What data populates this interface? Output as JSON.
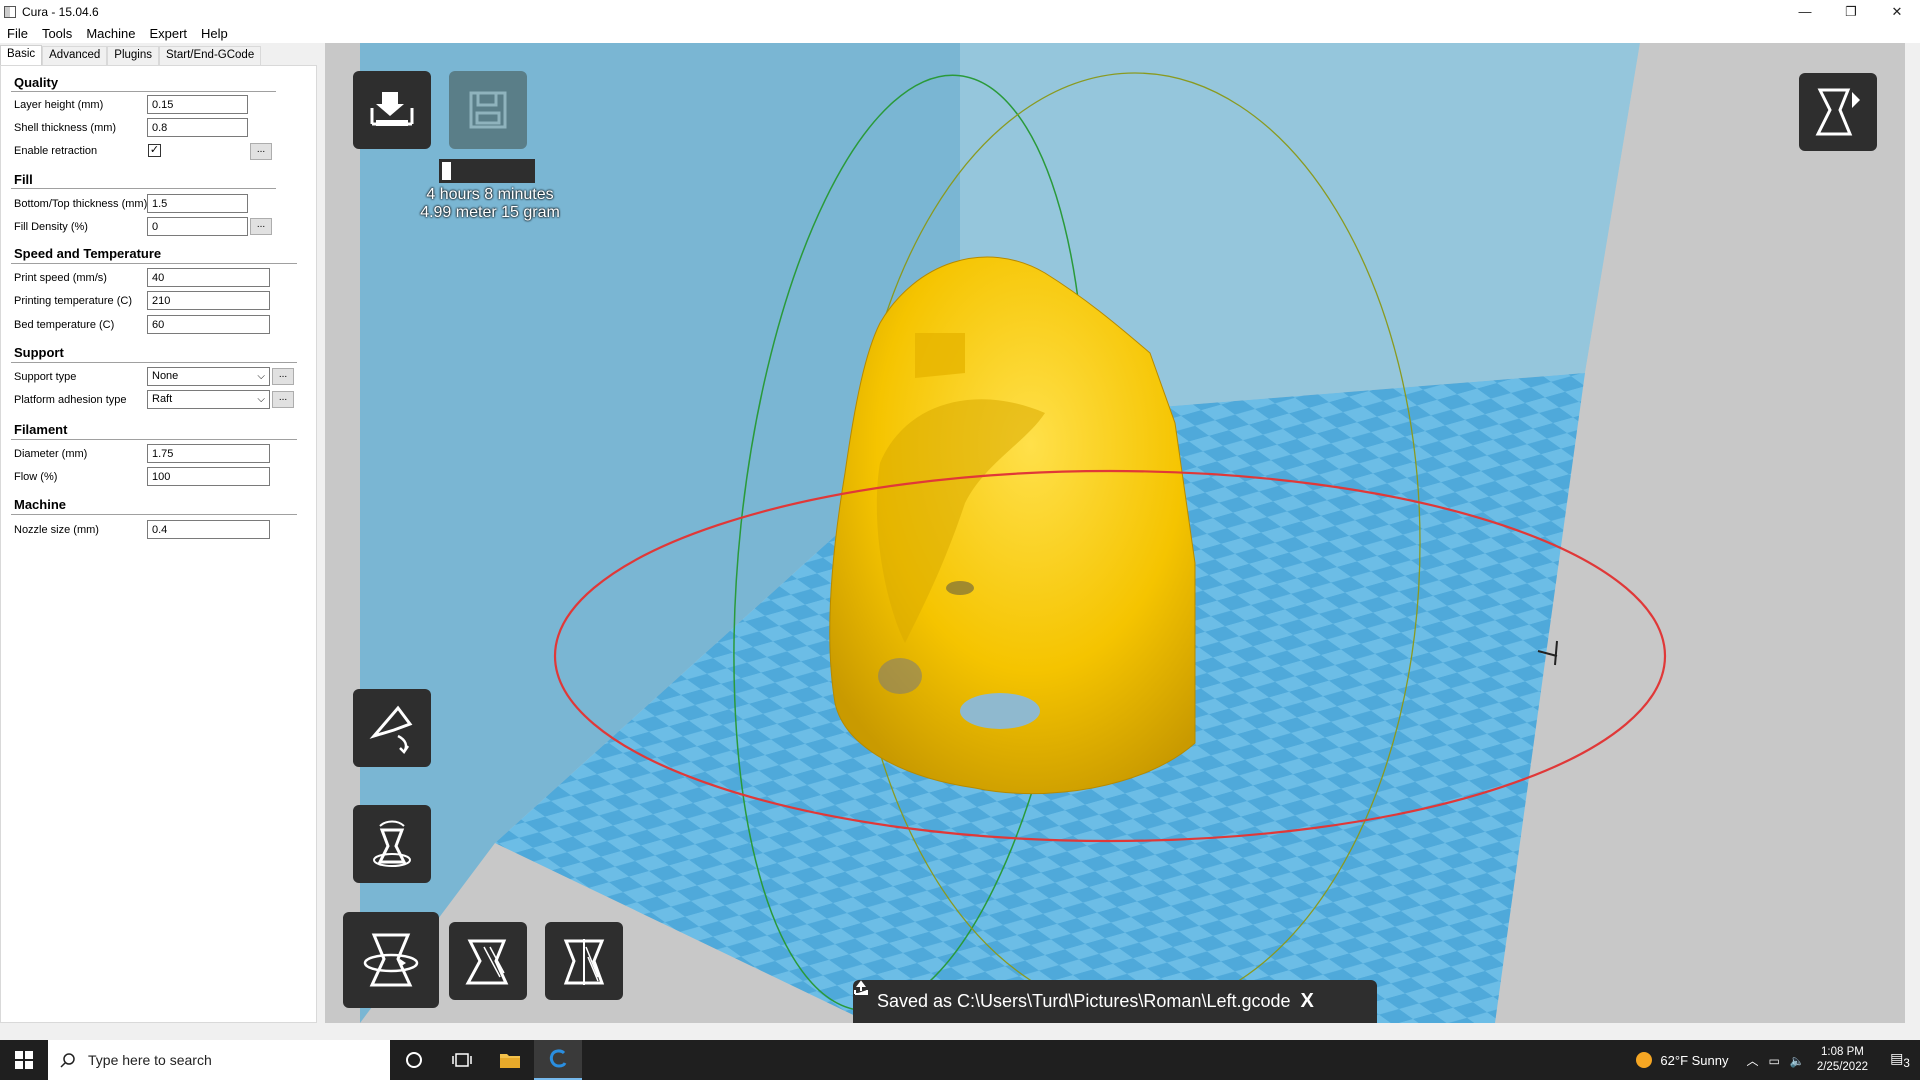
{
  "window": {
    "title": "Cura - 15.04.6",
    "minimize": "—",
    "maximize": "❐",
    "close": "✕"
  },
  "menu": [
    "File",
    "Tools",
    "Machine",
    "Expert",
    "Help"
  ],
  "tabs": [
    "Basic",
    "Advanced",
    "Plugins",
    "Start/End-GCode"
  ],
  "quality": {
    "title": "Quality",
    "layer_height_label": "Layer height (mm)",
    "layer_height": "0.15",
    "shell_thickness_label": "Shell thickness (mm)",
    "shell_thickness": "0.8",
    "retraction_label": "Enable retraction",
    "retraction_checked": "✓"
  },
  "fill": {
    "title": "Fill",
    "bottom_top_label": "Bottom/Top thickness (mm)",
    "bottom_top": "1.5",
    "density_label": "Fill Density (%)",
    "density": "0"
  },
  "speed": {
    "title": "Speed and Temperature",
    "print_speed_label": "Print speed (mm/s)",
    "print_speed": "40",
    "print_temp_label": "Printing temperature (C)",
    "print_temp": "210",
    "bed_temp_label": "Bed temperature (C)",
    "bed_temp": "60"
  },
  "support": {
    "title": "Support",
    "type_label": "Support type",
    "type": "None",
    "adhesion_label": "Platform adhesion type",
    "adhesion": "Raft"
  },
  "filament": {
    "title": "Filament",
    "diameter_label": "Diameter (mm)",
    "diameter": "1.75",
    "flow_label": "Flow (%)",
    "flow": "100"
  },
  "machine": {
    "title": "Machine",
    "nozzle_label": "Nozzle size (mm)",
    "nozzle": "0.4"
  },
  "dots": "...",
  "dropdown_arrow": "⌵",
  "print_info": {
    "time": "4 hours 8 minutes",
    "material": "4.99 meter 15 gram",
    "progress": 0.1
  },
  "notification": {
    "text": "Saved as C:\\Users\\Turd\\Pictures\\Roman\\Left.gcode",
    "close": "X"
  },
  "icons": {
    "load": "load-model-icon",
    "save": "save-gcode-icon",
    "view_mode": "view-mode-icon",
    "rotate": "rotate-icon",
    "scale": "scale-icon",
    "mirror": "mirror-icon",
    "layflat": "lay-flat-icon",
    "reset": "reset-icon"
  },
  "taskbar": {
    "search_placeholder": "Type here to search",
    "weather": "62°F  Sunny",
    "time": "1:08 PM",
    "date": "2/25/2022",
    "notif_count": "3"
  },
  "colors": {
    "viewport_bg": "#c8c8c8",
    "back_wall": "#7fbad6",
    "floor": "#5fb2e0",
    "model": "#f5c400",
    "ring": "#e03030",
    "panel_dark": "#2e2e2e"
  }
}
